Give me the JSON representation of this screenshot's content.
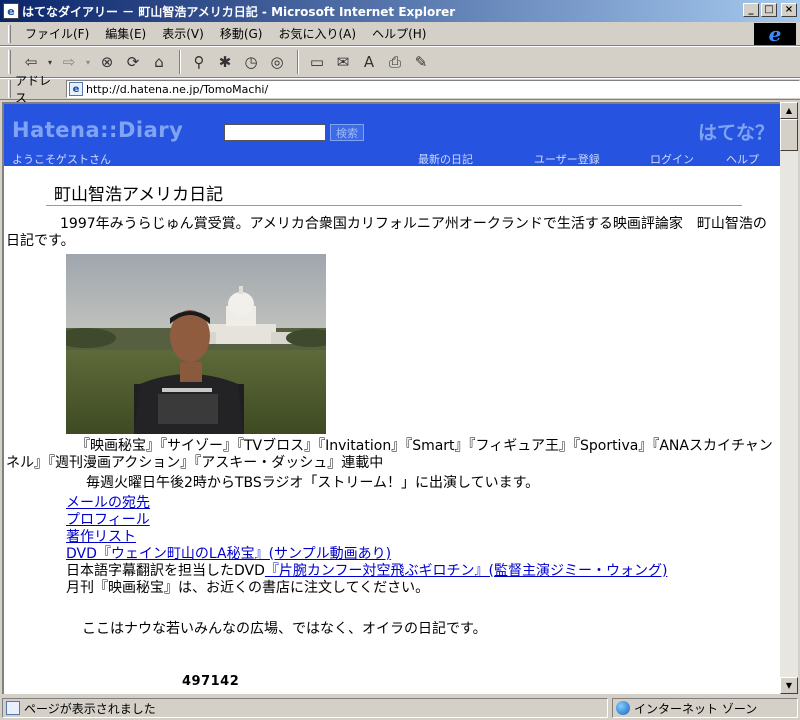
{
  "window": {
    "title": "はてなダイアリー － 町山智浩アメリカ日記 - Microsoft Internet Explorer",
    "minimize": "_",
    "maximize": "□",
    "close": "×"
  },
  "menu": [
    "ファイル(F)",
    "編集(E)",
    "表示(V)",
    "移動(G)",
    "お気に入り(A)",
    "ヘルプ(H)"
  ],
  "toolbar": {
    "icons": [
      "back-icon",
      "forward-icon",
      "stop-icon",
      "refresh-icon",
      "home-icon",
      "search-icon",
      "favorites-icon",
      "history-icon",
      "channels-icon",
      "fullscreen-icon",
      "mail-icon",
      "font-icon",
      "print-icon",
      "edit-icon"
    ]
  },
  "address": {
    "label": "アドレス",
    "url": "http://d.hatena.ne.jp/TomoMachi/"
  },
  "hatena": {
    "logo": "Hatena::Diary",
    "search_button": "検索",
    "mark": "はてな？",
    "welcome": "ようこそゲストさん",
    "nav": [
      "最新の日記",
      "ユーザー登録",
      "ログイン",
      "ヘルプ"
    ]
  },
  "page": {
    "title": "町山智浩アメリカ日記",
    "intro": "1997年みうらじゅん賞受賞。アメリカ合衆国カリフォルニア州オークランドで生活する映画評論家　町山智浩の日記です。",
    "magazines": "『映画秘宝』『サイゾー』『TVブロス』『Invitation』『Smart』『フィギュア王』『Sportiva』『ANAスカイチャンネル』『週刊漫画アクション』『アスキー・ダッシュ』連載中",
    "radio": "毎週火曜日午後2時からTBSラジオ「ストリーム！」に出演しています。",
    "links": [
      "メールの宛先",
      "プロフィール",
      "著作リスト",
      "DVD『ウェイン町山のLA秘宝』(サンプル動画あり)"
    ],
    "dvd_prefix": "日本語字幕翻訳を担当したDVD",
    "dvd_link": "『片腕カンフー対空飛ぶギロチン』(監督主演ジミー・ウォング)",
    "order_note": "月刊『映画秘宝』は、お近くの書店に注文してください。",
    "motto": "ここはナウな若いみんなの広場、ではなく、オイラの日記です。",
    "counter": "497142"
  },
  "status": {
    "text": "ページが表示されました",
    "zone": "インターネット ゾーン"
  }
}
